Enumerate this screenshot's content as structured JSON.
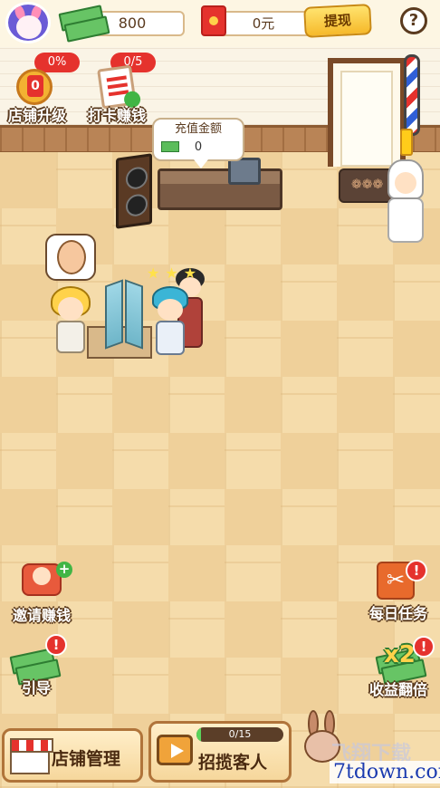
{
  "topbar": {
    "coins": "800",
    "rmb": "0元",
    "withdraw_label": "提现",
    "help_label": "?"
  },
  "features": {
    "shop_upgrade": {
      "badge": "0%",
      "level": "0",
      "label": "店铺升级"
    },
    "checkin": {
      "badge": "0/5",
      "label": "打卡赚钱"
    }
  },
  "counter_bubble": {
    "title": "充值金额",
    "value": "0"
  },
  "side_left": {
    "invite_label": "邀请赚钱",
    "guide_label": "引导",
    "alert": "!"
  },
  "side_right": {
    "daily_task_label": "每日任务",
    "double_income_label": "收益翻倍",
    "x2_text": "x2",
    "alert": "!"
  },
  "bottom": {
    "manage_label": "店铺管理",
    "recruit_label": "招揽客人",
    "progress_text": "0/15",
    "progress_fraction": 0.05
  },
  "watermark": {
    "faded_text": "飞翔下载",
    "site": "7tdown.com"
  }
}
